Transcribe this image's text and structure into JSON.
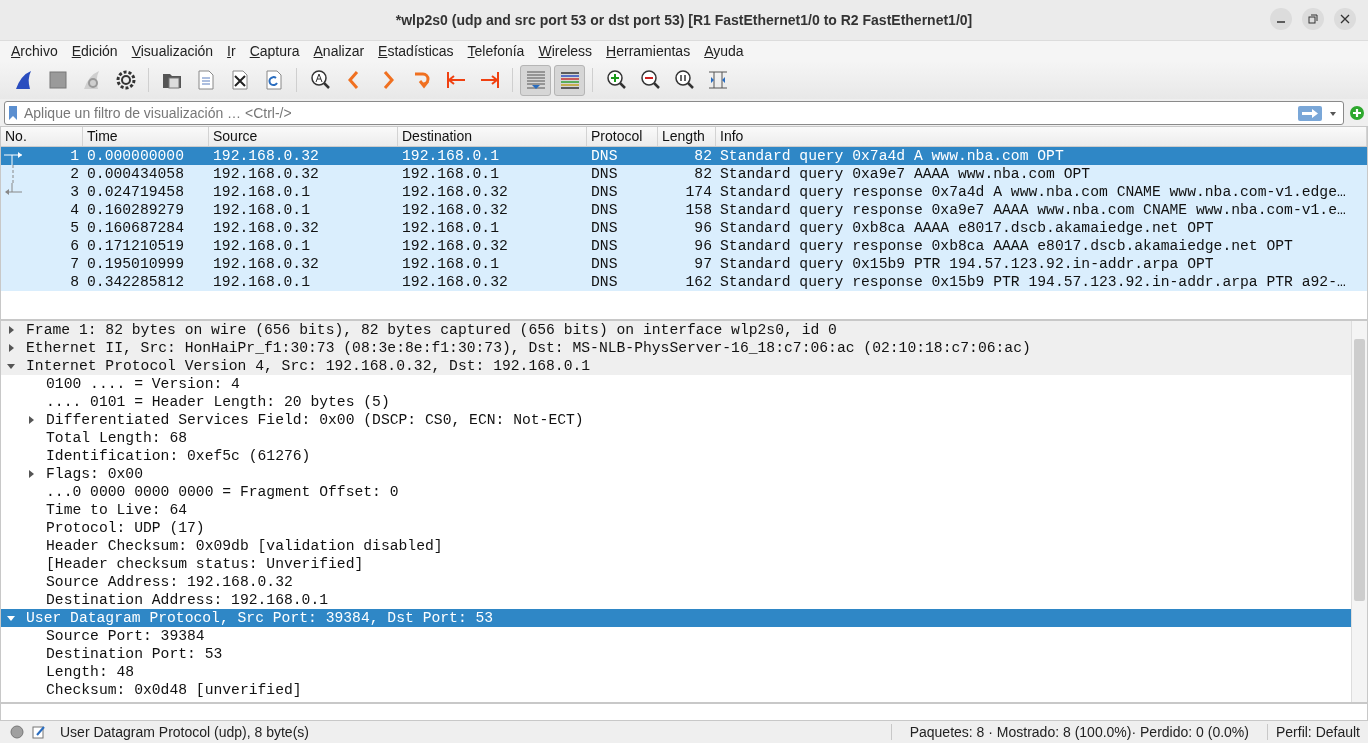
{
  "window": {
    "title": "*wlp2s0 (udp and src port 53 or dst port 53) [R1 FastEthernet1/0 to R2 FastEthernet1/0]"
  },
  "menu": [
    "Archivo",
    "Edición",
    "Visualización",
    "Ir",
    "Captura",
    "Analizar",
    "Estadísticas",
    "Telefonía",
    "Wireless",
    "Herramientas",
    "Ayuda"
  ],
  "toolbar": [
    {
      "pressed": false
    },
    {
      "pressed": false
    },
    {
      "pressed": false
    },
    {
      "pressed": false
    },
    {
      "pressed": false
    },
    {
      "pressed": false
    },
    {
      "pressed": false
    },
    {
      "pressed": false
    },
    {
      "pressed": false
    },
    {
      "pressed": false
    },
    {
      "pressed": false
    },
    {
      "pressed": false
    },
    {
      "pressed": false
    },
    {
      "pressed": false
    },
    {
      "pressed": true
    },
    {
      "pressed": true
    },
    {
      "pressed": false
    },
    {
      "pressed": false
    },
    {
      "pressed": false
    },
    {
      "pressed": false
    }
  ],
  "filter": {
    "placeholder": "Aplique un filtro de visualización … <Ctrl-/>"
  },
  "packet_list": {
    "columns": [
      "No.",
      "Time",
      "Source",
      "Destination",
      "Protocol",
      "Length",
      "Info"
    ],
    "rows": [
      {
        "cells": [
          "1",
          "0.000000000",
          "192.168.0.32",
          "192.168.0.1",
          "DNS",
          "82",
          "Standard query 0x7a4d A www.nba.com OPT"
        ],
        "selected": true,
        "kind": "request"
      },
      {
        "cells": [
          "2",
          "0.000434058",
          "192.168.0.32",
          "192.168.0.1",
          "DNS",
          "82",
          "Standard query 0xa9e7 AAAA www.nba.com OPT"
        ],
        "selected": false,
        "kind": "span"
      },
      {
        "cells": [
          "3",
          "0.024719458",
          "192.168.0.1",
          "192.168.0.32",
          "DNS",
          "174",
          "Standard query response 0x7a4d A www.nba.com CNAME www.nba.com-v1.edge…"
        ],
        "selected": false,
        "kind": "response"
      },
      {
        "cells": [
          "4",
          "0.160289279",
          "192.168.0.1",
          "192.168.0.32",
          "DNS",
          "158",
          "Standard query response 0xa9e7 AAAA www.nba.com CNAME www.nba.com-v1.e…"
        ],
        "selected": false,
        "kind": "plain"
      },
      {
        "cells": [
          "5",
          "0.160687284",
          "192.168.0.32",
          "192.168.0.1",
          "DNS",
          "96",
          "Standard query 0xb8ca AAAA e8017.dscb.akamaiedge.net OPT"
        ],
        "selected": false,
        "kind": "plain"
      },
      {
        "cells": [
          "6",
          "0.171210519",
          "192.168.0.1",
          "192.168.0.32",
          "DNS",
          "96",
          "Standard query response 0xb8ca AAAA e8017.dscb.akamaiedge.net OPT"
        ],
        "selected": false,
        "kind": "plain"
      },
      {
        "cells": [
          "7",
          "0.195010999",
          "192.168.0.32",
          "192.168.0.1",
          "DNS",
          "97",
          "Standard query 0x15b9 PTR 194.57.123.92.in-addr.arpa OPT"
        ],
        "selected": false,
        "kind": "plain"
      },
      {
        "cells": [
          "8",
          "0.342285812",
          "192.168.0.1",
          "192.168.0.32",
          "DNS",
          "162",
          "Standard query response 0x15b9 PTR 194.57.123.92.in-addr.arpa PTR a92-…"
        ],
        "selected": false,
        "kind": "plain"
      }
    ]
  },
  "details": [
    {
      "text": "Frame 1: 82 bytes on wire (656 bits), 82 bytes captured (656 bits) on interface wlp2s0, id 0",
      "expanded": false,
      "selected": false
    },
    {
      "text": "Ethernet II, Src: HonHaiPr_f1:30:73 (08:3e:8e:f1:30:73), Dst: MS-NLB-PhysServer-16_18:c7:06:ac (02:10:18:c7:06:ac)",
      "expanded": false,
      "selected": false
    },
    {
      "text": "Internet Protocol Version 4, Src: 192.168.0.32, Dst: 192.168.0.1",
      "expanded": true,
      "selected": false,
      "children": [
        {
          "text": "0100 .... = Version: 4",
          "selected": false
        },
        {
          "text": ".... 0101 = Header Length: 20 bytes (5)",
          "selected": false
        },
        {
          "text": "Differentiated Services Field: 0x00 (DSCP: CS0, ECN: Not-ECT)",
          "expanded": false,
          "selected": false
        },
        {
          "text": "Total Length: 68",
          "selected": false
        },
        {
          "text": "Identification: 0xef5c (61276)",
          "selected": false
        },
        {
          "text": "Flags: 0x00",
          "expanded": false,
          "selected": false
        },
        {
          "text": "...0 0000 0000 0000 = Fragment Offset: 0",
          "selected": false
        },
        {
          "text": "Time to Live: 64",
          "selected": false
        },
        {
          "text": "Protocol: UDP (17)",
          "selected": false
        },
        {
          "text": "Header Checksum: 0x09db [validation disabled]",
          "selected": false
        },
        {
          "text": "[Header checksum status: Unverified]",
          "selected": false
        },
        {
          "text": "Source Address: 192.168.0.32",
          "selected": false
        },
        {
          "text": "Destination Address: 192.168.0.1",
          "selected": false
        }
      ]
    },
    {
      "text": "User Datagram Protocol, Src Port: 39384, Dst Port: 53",
      "expanded": true,
      "selected": true,
      "children": [
        {
          "text": "Source Port: 39384",
          "selected": false
        },
        {
          "text": "Destination Port: 53",
          "selected": false
        },
        {
          "text": "Length: 48",
          "selected": false
        },
        {
          "text": "Checksum: 0x0d48 [unverified]",
          "selected": false
        }
      ]
    }
  ],
  "status_bar": {
    "field": "User Datagram Protocol (udp), 8 byte(s)",
    "stats": "Paquetes: 8 · Mostrado: 8 (100.0%)· Perdido: 0 (0.0%)",
    "profile": "Perfil: Default"
  }
}
